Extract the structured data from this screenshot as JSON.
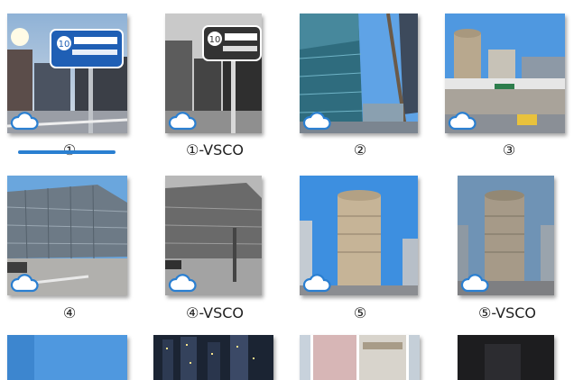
{
  "items": [
    {
      "label": "①",
      "photo": "street-sign-color",
      "cloud": "cloud-icon"
    },
    {
      "label": "①-VSCO",
      "photo": "street-sign-bw",
      "cloud": "cloud-icon"
    },
    {
      "label": "②",
      "photo": "glass-building-pole",
      "cloud": "cloud-icon"
    },
    {
      "label": "③",
      "photo": "station-building",
      "cloud": "cloud-icon"
    },
    {
      "label": "④",
      "photo": "corner-building-color",
      "cloud": "cloud-icon"
    },
    {
      "label": "④-VSCO",
      "photo": "corner-building-bw",
      "cloud": "cloud-icon"
    },
    {
      "label": "⑤",
      "photo": "round-building-color",
      "cloud": "cloud-icon"
    },
    {
      "label": "⑤-VSCO",
      "photo": "round-building-muted",
      "cloud": "cloud-icon"
    },
    {
      "label": "",
      "photo": "sky-partial"
    },
    {
      "label": "",
      "photo": "night-city-partial"
    },
    {
      "label": "",
      "photo": "collage-partial"
    },
    {
      "label": "",
      "photo": "dark-partial"
    }
  ],
  "selected_index": 0,
  "colors": {
    "accent": "#2a7fd1",
    "cloud_fill": "#ffffff",
    "cloud_stroke": "#2a7fd1"
  }
}
